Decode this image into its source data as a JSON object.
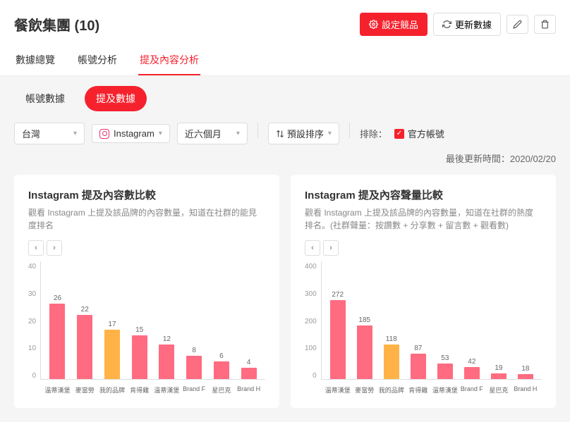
{
  "header": {
    "title": "餐飲集團 (10)",
    "btn_settings": "設定競品",
    "btn_refresh": "更新數據"
  },
  "tabs": [
    "數據總覽",
    "帳號分析",
    "提及內容分析"
  ],
  "active_tab": 2,
  "sub_tabs": [
    "帳號數據",
    "提及數據"
  ],
  "active_sub_tab": 1,
  "filters": {
    "region": "台灣",
    "platform": "Instagram",
    "period": "近六個月",
    "sort": "預設排序",
    "exclude_label": "排除：",
    "exclude_official": "官方帳號",
    "last_update_label": "最後更新時間：",
    "last_update_value": "2020/02/20"
  },
  "cards": [
    {
      "title": "Instagram 提及內容數比較",
      "desc": "觀看 Instagram 上提及該品牌的內容數量，知道在社群的能見度排名"
    },
    {
      "title": "Instagram 提及內容聲量比較",
      "desc": "觀看 Instagram 上提及該品牌的內容數量，知道在社群的熱度排名。(社群聲量：按讚數 + 分享數 + 留言數 + 觀看數)"
    }
  ],
  "chart_data": [
    {
      "type": "bar",
      "title": "Instagram 提及內容數比較",
      "categories": [
        "溫蒂漢堡",
        "麥當勞",
        "我的品牌",
        "肯得雞",
        "溫蒂漢堡",
        "Brand F",
        "星巴克",
        "Brand H"
      ],
      "values": [
        26,
        22,
        17,
        15,
        12,
        8,
        6,
        4
      ],
      "self_index": 2,
      "ylim": [
        0,
        40
      ],
      "yticks": [
        0,
        10,
        20,
        30,
        40
      ],
      "xlabel": "",
      "ylabel": ""
    },
    {
      "type": "bar",
      "title": "Instagram 提及內容聲量比較",
      "categories": [
        "溫蒂漢堡",
        "麥當勞",
        "我的品牌",
        "肯得雞",
        "溫蒂漢堡",
        "Brand F",
        "星巴克",
        "Brand H"
      ],
      "values": [
        272,
        185,
        118,
        87,
        53,
        42,
        19,
        18
      ],
      "self_index": 2,
      "ylim": [
        0,
        400
      ],
      "yticks": [
        0,
        100,
        200,
        300,
        400
      ],
      "xlabel": "",
      "ylabel": ""
    }
  ]
}
